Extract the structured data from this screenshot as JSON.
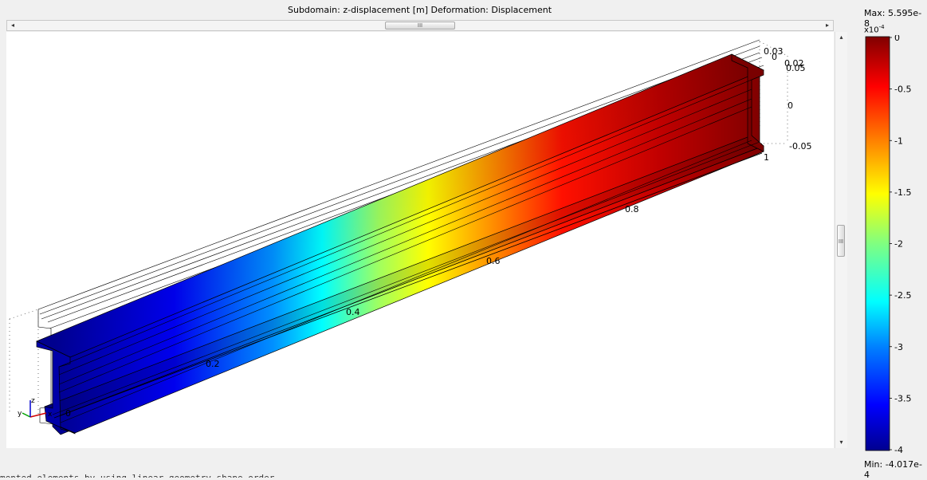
{
  "header": {
    "title": "Subdomain: z-displacement [m]   Deformation: Displacement"
  },
  "scrollbars": {
    "left_arrow": "◂",
    "right_arrow": "▸",
    "up_arrow": "▴",
    "down_arrow": "▾",
    "grip": "III"
  },
  "plot": {
    "x_ticks": [
      "0",
      "0.2",
      "0.4",
      "0.6",
      "0.8",
      "1"
    ],
    "y_ticks": [
      "0.02",
      "0.05"
    ],
    "z_ticks": [
      "0.03",
      "0",
      "0",
      "-0.05"
    ],
    "axis_triad": {
      "x": "x",
      "y": "y",
      "z": "z"
    },
    "color_gradient": [
      "#00008f",
      "#0000ff",
      "#0080ff",
      "#00ffff",
      "#80ff80",
      "#ffff00",
      "#ff8000",
      "#ff0000",
      "#800000"
    ]
  },
  "colorbar": {
    "max_label": "Max: 5.595e-8",
    "scale_base": "x10",
    "scale_exp": "-4",
    "ticks": [
      "0",
      "-0.5",
      "-1",
      "-1.5",
      "-2",
      "-2.5",
      "-3",
      "-3.5",
      "-4"
    ],
    "min_label": "Min: -4.017e-4"
  },
  "status": {
    "text": "mented elements by using linear geometry shape order"
  }
}
